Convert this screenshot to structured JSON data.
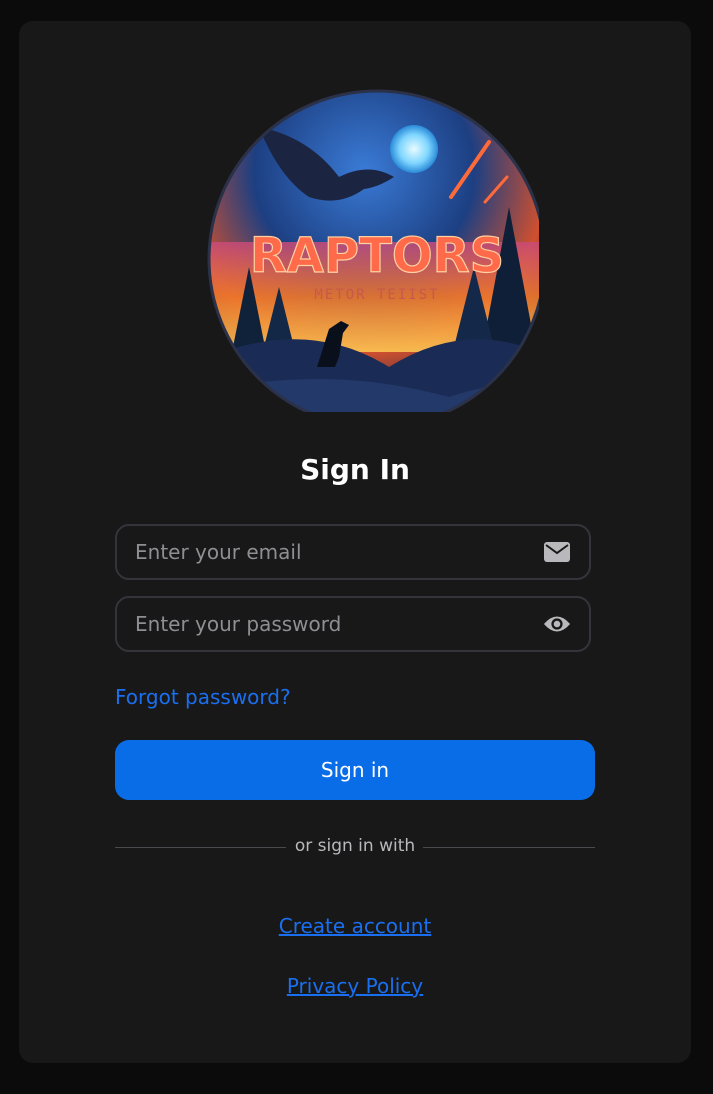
{
  "logo": {
    "title_text": "RAPTORS",
    "subtitle_text": "METOR TEIIST"
  },
  "header": {
    "title": "Sign In"
  },
  "form": {
    "email_placeholder": "Enter your email",
    "email_value": "",
    "email_icon": "mail-icon",
    "password_placeholder": "Enter your password",
    "password_value": "",
    "password_icon": "eye-icon",
    "forgot_label": "Forgot password?",
    "submit_label": "Sign in"
  },
  "divider": {
    "label": "or sign in with"
  },
  "footer": {
    "create_account": "Create account",
    "privacy_policy": "Privacy Policy"
  },
  "colors": {
    "background": "#0b0b0b",
    "card": "#181818",
    "accent": "#0a6de8",
    "link": "#1a6ff0",
    "field_border": "#34343a"
  }
}
